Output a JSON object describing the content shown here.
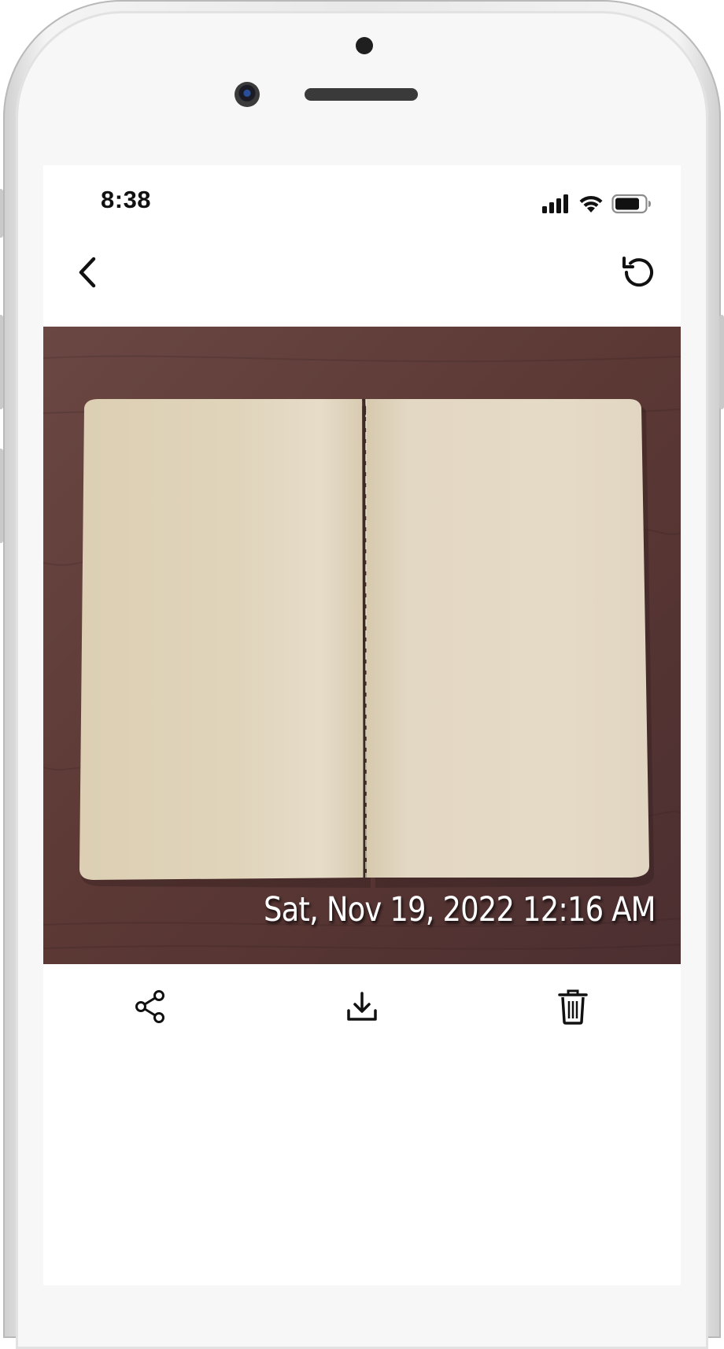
{
  "status_bar": {
    "time": "8:38",
    "icons": [
      "cellular-signal-icon",
      "wifi-icon",
      "battery-icon"
    ]
  },
  "nav": {
    "back_icon": "chevron-left-icon",
    "rotate_icon": "rotate-ccw-icon"
  },
  "photo": {
    "subject": "open-blank-notebook",
    "timestamp": "Sat, Nov 19, 2022 12:16 AM"
  },
  "toolbar": {
    "actions": [
      {
        "icon": "share-icon"
      },
      {
        "icon": "download-icon"
      },
      {
        "icon": "trash-icon"
      }
    ]
  },
  "colors": {
    "wood": "#5c3a36",
    "paper": "#e2d6c0",
    "icon": "#111111",
    "timestamp_text": "#ffffff"
  }
}
